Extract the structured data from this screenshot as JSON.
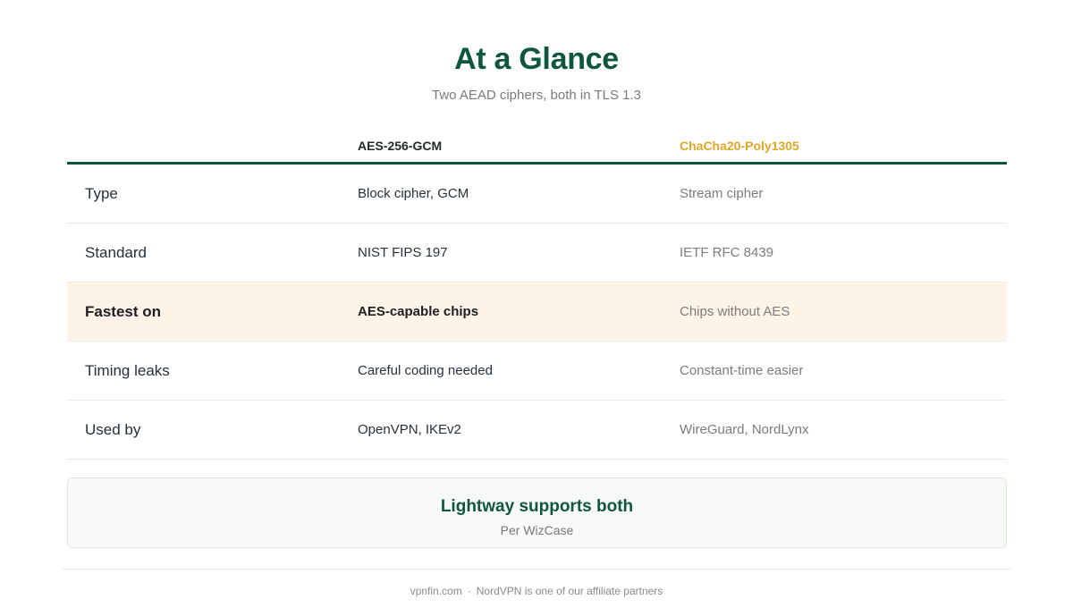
{
  "header": {
    "title": "At a Glance",
    "subtitle": "Two AEAD ciphers, both in TLS 1.3"
  },
  "table": {
    "columns": [
      "",
      "AES-256-GCM",
      "ChaCha20-Poly1305"
    ],
    "rows": [
      {
        "label": "Type",
        "aes": "Block cipher, GCM",
        "chacha": "Stream cipher",
        "highlighted": false
      },
      {
        "label": "Standard",
        "aes": "NIST FIPS 197",
        "chacha": "IETF RFC 8439",
        "highlighted": false
      },
      {
        "label": "Fastest on",
        "aes": "AES-capable chips",
        "chacha": "Chips without AES",
        "highlighted": true
      },
      {
        "label": "Timing leaks",
        "aes": "Careful coding needed",
        "chacha": "Constant-time easier",
        "highlighted": false
      },
      {
        "label": "Used by",
        "aes": "OpenVPN, IKEv2",
        "chacha": "WireGuard, NordLynx",
        "highlighted": false
      }
    ]
  },
  "callout": {
    "title": "Lightway supports both",
    "source": "Per WizCase"
  },
  "footer": {
    "site": "vpnfin.com",
    "separator": "·",
    "disclosure": "NordVPN is one of our affiliate partners"
  },
  "colors": {
    "brand_green": "#0f5640",
    "accent_gold": "#e4a624",
    "highlight_row": "#fdf3e6"
  }
}
